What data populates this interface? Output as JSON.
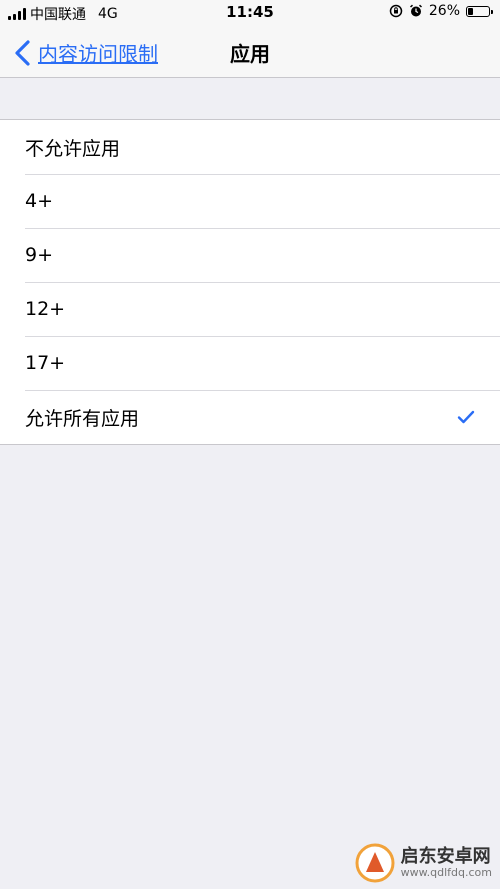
{
  "status_bar": {
    "carrier": "中国联通",
    "network": "4G",
    "time": "11:45",
    "battery": "26%",
    "battery_level": 0.26
  },
  "nav": {
    "back_label": "内容访问限制",
    "title": "应用"
  },
  "options": [
    {
      "label": "不允许应用",
      "selected": false
    },
    {
      "label": "4+",
      "selected": false
    },
    {
      "label": "9+",
      "selected": false
    },
    {
      "label": "12+",
      "selected": false
    },
    {
      "label": "17+",
      "selected": false
    },
    {
      "label": "允许所有应用",
      "selected": true
    }
  ],
  "icons": {
    "back": "chevron-left-icon",
    "check": "checkmark-icon",
    "rotation_lock": "rotation-lock-icon",
    "alarm": "alarm-icon",
    "signal": "signal-icon",
    "battery": "battery-icon"
  },
  "colors": {
    "accent": "#2a6df5",
    "background": "#efeff4"
  },
  "watermark": {
    "title": "启东安卓网",
    "url": "www.qdlfdq.com"
  }
}
